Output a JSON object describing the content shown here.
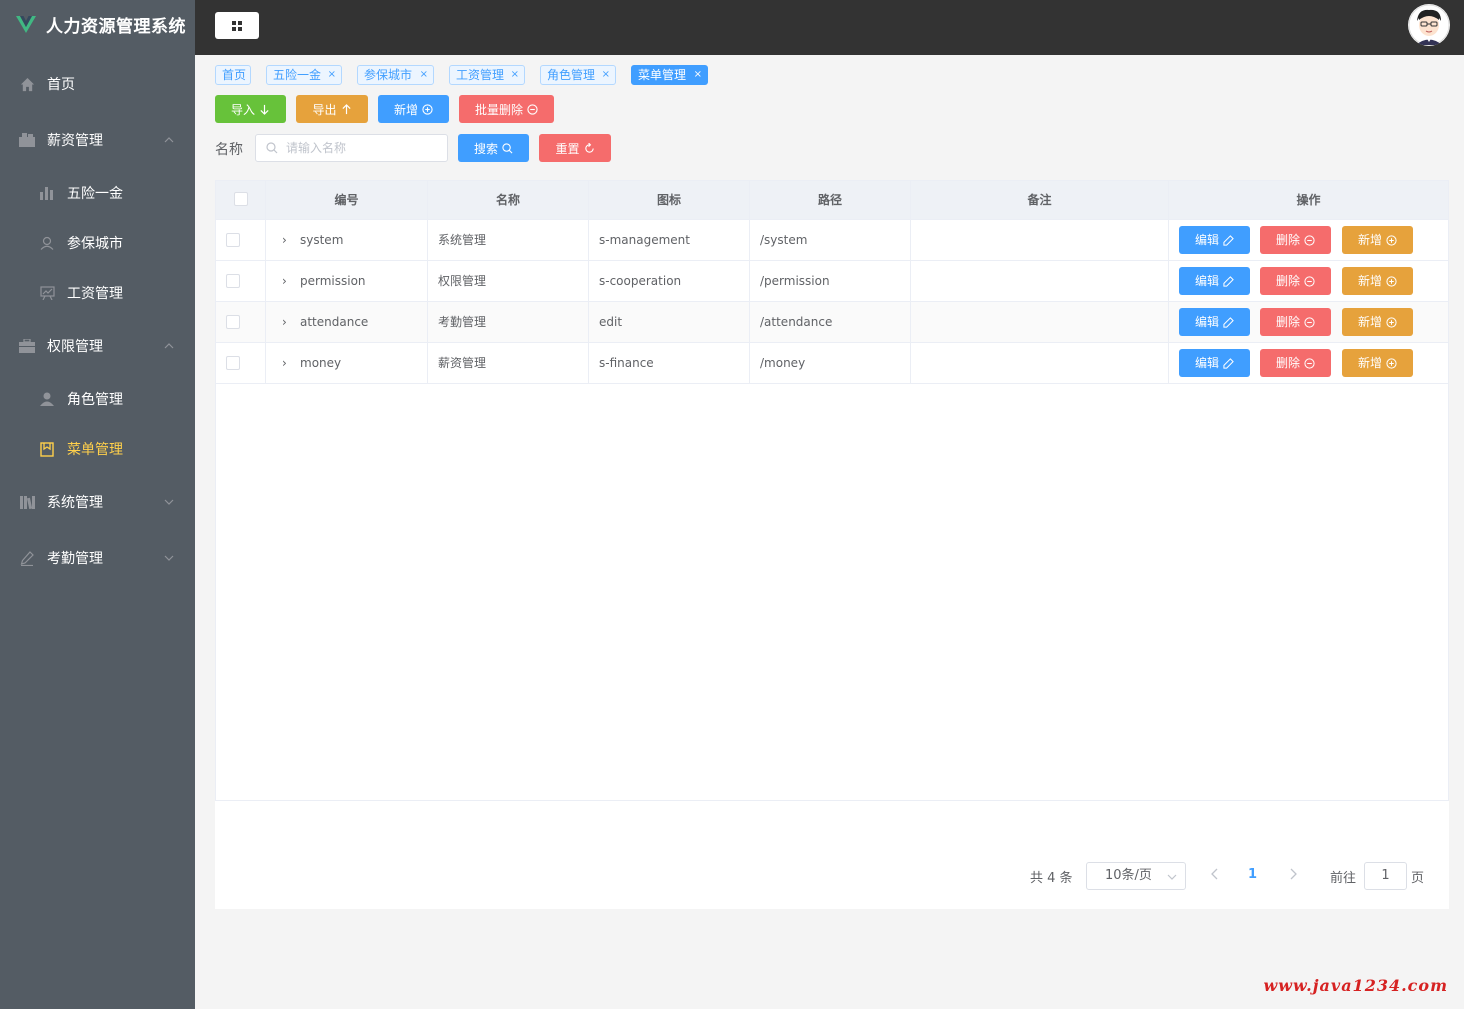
{
  "app": {
    "title": "人力资源管理系统"
  },
  "sidebar": {
    "items": [
      {
        "label": "首页"
      },
      {
        "label": "薪资管理"
      },
      {
        "label": "五险一金"
      },
      {
        "label": "参保城市"
      },
      {
        "label": "工资管理"
      },
      {
        "label": "权限管理"
      },
      {
        "label": "角色管理"
      },
      {
        "label": "菜单管理"
      },
      {
        "label": "系统管理"
      },
      {
        "label": "考勤管理"
      }
    ]
  },
  "tags": [
    {
      "label": "首页"
    },
    {
      "label": "五险一金"
    },
    {
      "label": "参保城市"
    },
    {
      "label": "工资管理"
    },
    {
      "label": "角色管理"
    },
    {
      "label": "菜单管理"
    }
  ],
  "toolbar": {
    "import_label": "导入",
    "export_label": "导出",
    "add_label": "新增",
    "batch_delete_label": "批量删除"
  },
  "search": {
    "label": "名称",
    "placeholder": "请输入名称",
    "search_label": "搜索",
    "reset_label": "重置"
  },
  "table": {
    "columns": [
      "编号",
      "名称",
      "图标",
      "路径",
      "备注",
      "操作"
    ],
    "rows": [
      {
        "code": "system",
        "name": "系统管理",
        "icon": "s-management",
        "path": "/system",
        "remark": ""
      },
      {
        "code": "permission",
        "name": "权限管理",
        "icon": "s-cooperation",
        "path": "/permission",
        "remark": ""
      },
      {
        "code": "attendance",
        "name": "考勤管理",
        "icon": "edit",
        "path": "/attendance",
        "remark": ""
      },
      {
        "code": "money",
        "name": "薪资管理",
        "icon": "s-finance",
        "path": "/money",
        "remark": ""
      }
    ],
    "actions": {
      "edit": "编辑",
      "delete": "删除",
      "add": "新增"
    }
  },
  "pagination": {
    "total_text": "共 4 条",
    "page_size": "10条/页",
    "current_page": "1",
    "goto_label": "前往",
    "goto_value": "1",
    "page_unit": "页"
  },
  "watermark": "www.java1234.com",
  "colors": {
    "sidebar_bg": "#545c64",
    "header_bg": "#333333",
    "active_menu": "#ffd04b",
    "primary": "#409eff",
    "success": "#67c23a",
    "warning": "#e6a23c",
    "danger": "#f56c6c"
  }
}
